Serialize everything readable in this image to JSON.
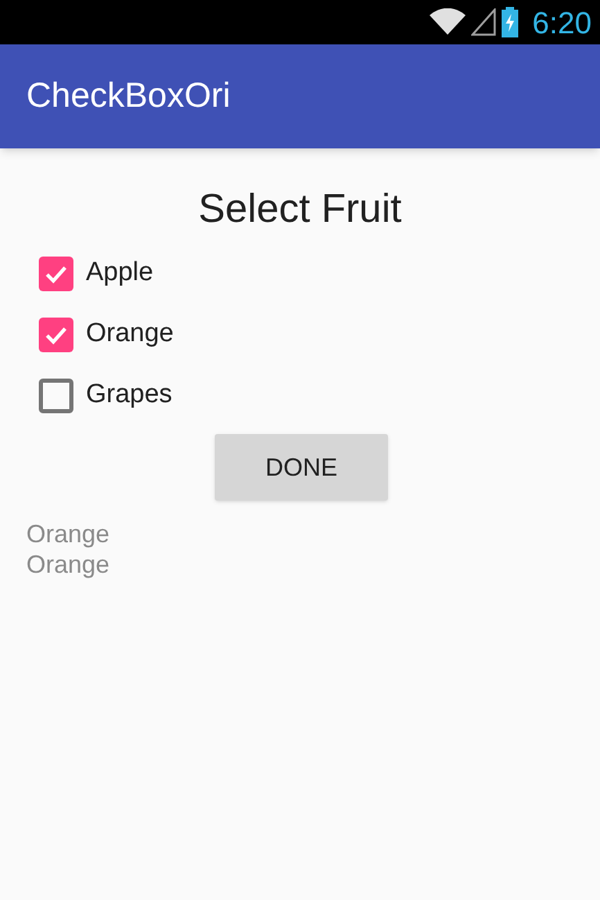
{
  "status_bar": {
    "time": "6:20"
  },
  "app_bar": {
    "title": "CheckBoxOri"
  },
  "heading": "Select Fruit",
  "checkboxes": [
    {
      "label": "Apple",
      "checked": true
    },
    {
      "label": "Orange",
      "checked": true
    },
    {
      "label": "Grapes",
      "checked": false
    }
  ],
  "button": "DONE",
  "output_lines": [
    "Orange",
    "Orange"
  ]
}
